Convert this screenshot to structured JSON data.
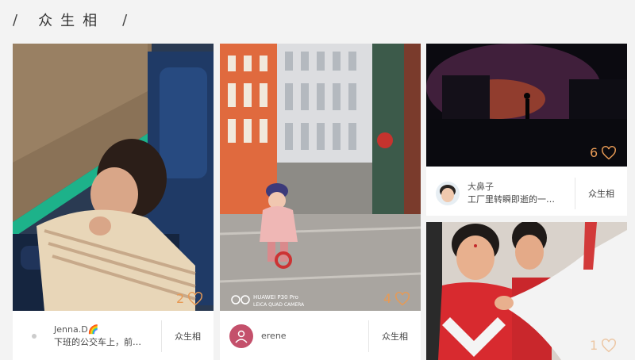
{
  "header": {
    "slash_left": "/",
    "title": "众生相",
    "slash_right": "/"
  },
  "cards": [
    {
      "author": "Jenna.D🌈",
      "description": "下班的公交车上，前…",
      "category": "众生相",
      "likes": "2"
    },
    {
      "author": "erene",
      "description": "",
      "category": "众生相",
      "likes": "4",
      "watermark_line1": "HUAWEI P30 Pro",
      "watermark_line2": "LEICA QUAD CAMERA"
    },
    {
      "author": "大鼻子",
      "description": "工厂里转瞬即逝的一…",
      "category": "众生相",
      "likes": "6"
    },
    {
      "likes": "1"
    }
  ],
  "colors": {
    "like_orange": "#e79a55",
    "avatar_red": "#c4506b"
  },
  "icons": {
    "like": "heart-outline-icon",
    "lens": "camera-lens-icon"
  }
}
